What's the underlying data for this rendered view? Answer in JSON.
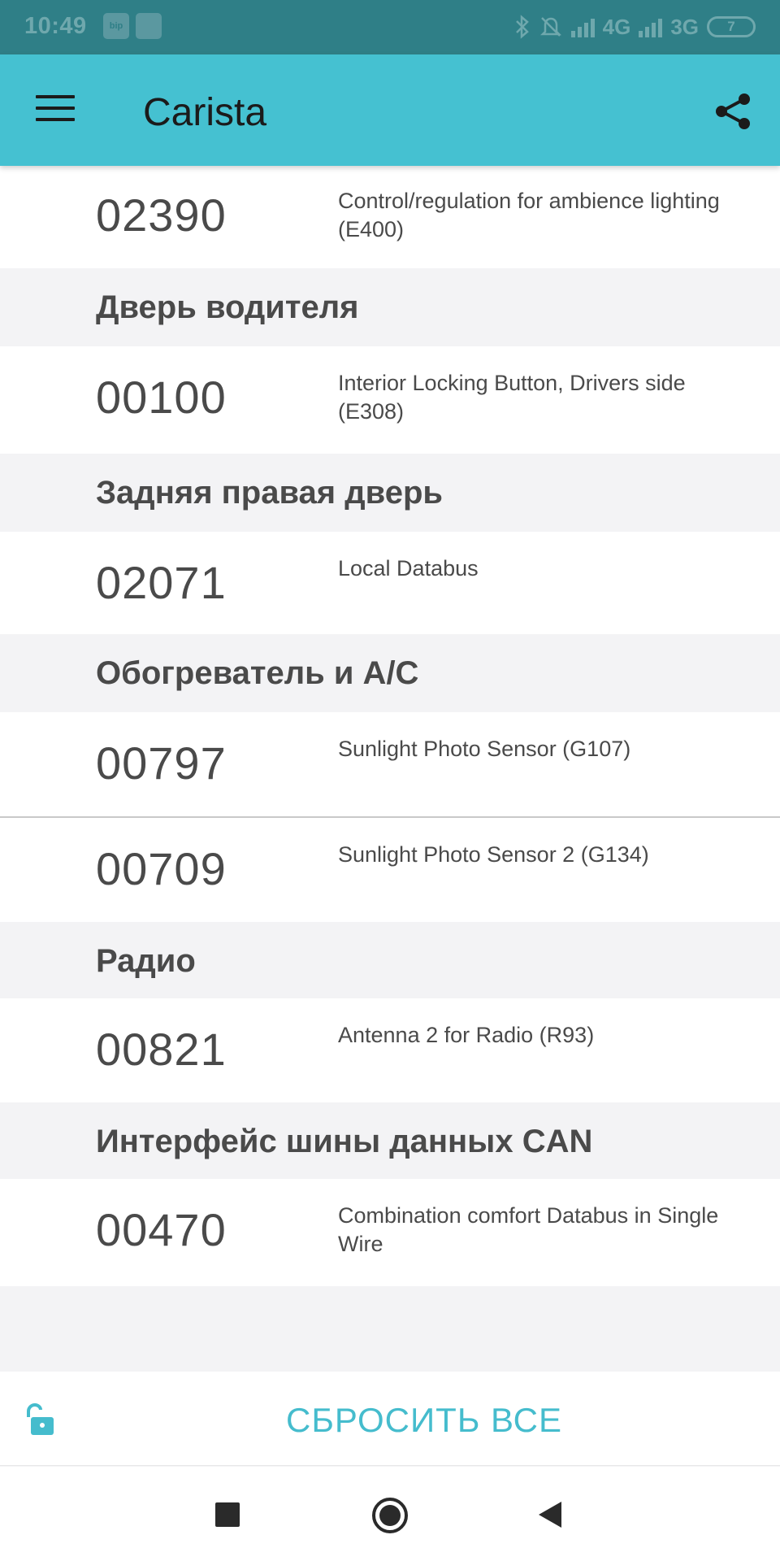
{
  "status_bar": {
    "time": "10:49",
    "app_icons": [
      "bip",
      ""
    ],
    "network_1": "4G",
    "network_2": "3G",
    "battery": "7"
  },
  "app_bar": {
    "title": "Carista",
    "menu_icon": "hamburger-menu-icon",
    "share_icon": "share-icon"
  },
  "sections": [
    {
      "type": "row",
      "code": "02390",
      "desc": "Control/regulation for ambience lighting (E400)"
    },
    {
      "type": "header",
      "title": "Дверь водителя"
    },
    {
      "type": "row",
      "code": "00100",
      "desc": "Interior Locking Button, Drivers side (E308)"
    },
    {
      "type": "header",
      "title": "Задняя правая дверь"
    },
    {
      "type": "row",
      "code": "02071",
      "desc": "Local Databus"
    },
    {
      "type": "header",
      "title": "Обогреватель и A/C"
    },
    {
      "type": "row",
      "code": "00797",
      "desc": "Sunlight Photo Sensor (G107)"
    },
    {
      "type": "row",
      "code": "00709",
      "desc": "Sunlight Photo Sensor 2 (G134)"
    },
    {
      "type": "header",
      "title": "Радио"
    },
    {
      "type": "row",
      "code": "00821",
      "desc": "Antenna 2 for Radio (R93)"
    },
    {
      "type": "header",
      "title": "Интерфейс шины данных CAN"
    },
    {
      "type": "row",
      "code": "00470",
      "desc": "Combination comfort Databus in Single Wire"
    }
  ],
  "action_bar": {
    "reset_label": "СБРОСИТЬ ВСЕ",
    "unlock_icon": "unlock-icon",
    "accent_color": "#45bccd"
  },
  "colors": {
    "app_bar": "#45c1d1",
    "status_bar": "#2f7f87",
    "background": "#f3f3f5"
  }
}
